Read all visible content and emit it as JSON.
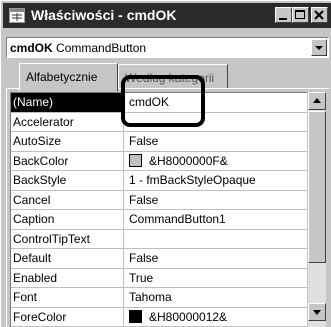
{
  "window": {
    "title": "Właściwości - cmdOK"
  },
  "object_selector": {
    "name": "cmdOK",
    "type": "CommandButton"
  },
  "tabs": [
    {
      "label": "Alfabetycznie",
      "active": true
    },
    {
      "label": "Według kategorii",
      "active": false
    }
  ],
  "properties": [
    {
      "name": "(Name)",
      "value": "cmdOK",
      "selected": true
    },
    {
      "name": "Accelerator",
      "value": ""
    },
    {
      "name": "AutoSize",
      "value": "False"
    },
    {
      "name": "BackColor",
      "value": "&H8000000F&",
      "swatch": "#c0c0c0"
    },
    {
      "name": "BackStyle",
      "value": "1 - fmBackStyleOpaque"
    },
    {
      "name": "Cancel",
      "value": "False"
    },
    {
      "name": "Caption",
      "value": "CommandButton1"
    },
    {
      "name": "ControlTipText",
      "value": ""
    },
    {
      "name": "Default",
      "value": "False"
    },
    {
      "name": "Enabled",
      "value": "True"
    },
    {
      "name": "Font",
      "value": "Tahoma"
    },
    {
      "name": "ForeColor",
      "value": "&H80000012&",
      "swatch": "#000000"
    }
  ],
  "colors": {
    "titlebar": "#2b2b2b",
    "face": "#c6c6c6",
    "selected": "#000000"
  }
}
